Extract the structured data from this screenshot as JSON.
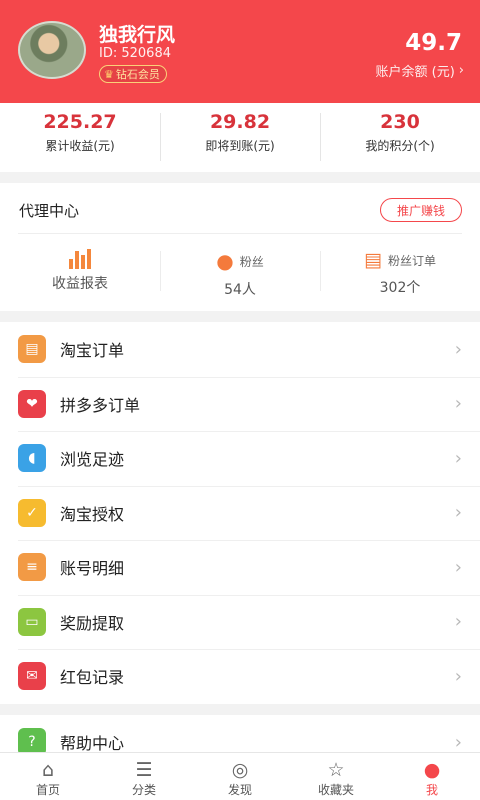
{
  "profile": {
    "name": "独我行风",
    "id": "ID: 520684",
    "vip": "钻石会员"
  },
  "account": {
    "balance": "49.7",
    "balance_label": "账户余额 (元)"
  },
  "stats": [
    {
      "value": "225.27",
      "label": "累计收益(元)"
    },
    {
      "value": "29.82",
      "label": "即将到账(元)"
    },
    {
      "value": "230",
      "label": "我的积分(个)"
    }
  ],
  "agent": {
    "title": "代理中心",
    "promo": "推广赚钱",
    "tiles": [
      {
        "label": "收益报表",
        "value": ""
      },
      {
        "label": "粉丝",
        "value": "54人"
      },
      {
        "label": "粉丝订单",
        "value": "302个"
      }
    ]
  },
  "menu": [
    {
      "label": "淘宝订单",
      "color": "#f29a45",
      "icon": "orders-icon"
    },
    {
      "label": "拼多多订单",
      "color": "#e9404a",
      "icon": "heart-pattern-icon"
    },
    {
      "label": "浏览足迹",
      "color": "#3aa2e6",
      "icon": "footprint-icon"
    },
    {
      "label": "淘宝授权",
      "color": "#f6bb2f",
      "icon": "shield-check-icon"
    },
    {
      "label": "账号明细",
      "color": "#f29a45",
      "icon": "account-detail-icon"
    },
    {
      "label": "奖励提取",
      "color": "#8cc640",
      "icon": "wallet-icon"
    },
    {
      "label": "红包记录",
      "color": "#e9404a",
      "icon": "red-envelope-icon"
    }
  ],
  "menu2": [
    {
      "label": "帮助中心",
      "color": "#5fbf4e",
      "icon": "help-icon"
    }
  ],
  "tabbar": [
    {
      "label": "首页",
      "icon": "home-icon"
    },
    {
      "label": "分类",
      "icon": "category-icon"
    },
    {
      "label": "发现",
      "icon": "compass-icon"
    },
    {
      "label": "收藏夹",
      "icon": "star-icon"
    },
    {
      "label": "我",
      "icon": "user-icon",
      "active": true
    }
  ]
}
